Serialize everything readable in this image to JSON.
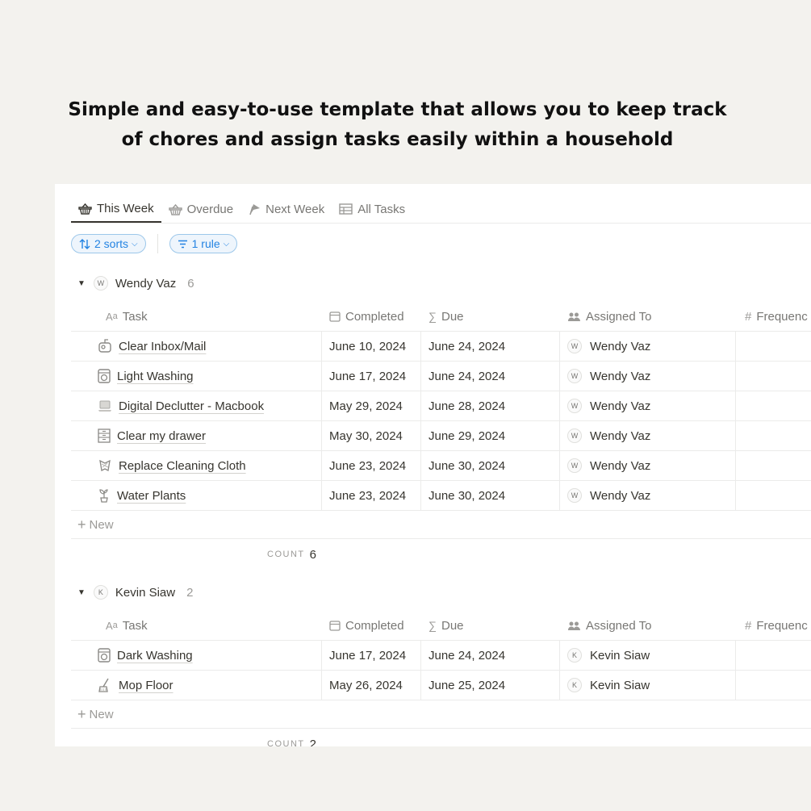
{
  "headline": {
    "line1": "Simple and easy-to-use template that allows you to keep track",
    "line2": "of chores and assign tasks easily within a household"
  },
  "tabs": [
    {
      "label": "This Week",
      "icon": "basket-icon",
      "active": true
    },
    {
      "label": "Overdue",
      "icon": "basket-icon",
      "active": false
    },
    {
      "label": "Next Week",
      "icon": "flag-icon",
      "active": false
    },
    {
      "label": "All Tasks",
      "icon": "table-icon",
      "active": false
    }
  ],
  "filters": {
    "sorts_label": "2 sorts",
    "rule_label": "1 rule"
  },
  "columns": {
    "task": "Task",
    "completed": "Completed",
    "due": "Due",
    "assigned": "Assigned To",
    "frequency": "Frequenc"
  },
  "new_label": "New",
  "count_label": "COUNT",
  "groups": [
    {
      "name": "Wendy Vaz",
      "initial": "W",
      "count": "6",
      "rows": [
        {
          "task": "Clear Inbox/Mail",
          "icon": "mailbox-icon",
          "completed": "June 10, 2024",
          "due": "June 24, 2024",
          "assigned": "Wendy Vaz",
          "initial": "W"
        },
        {
          "task": "Light Washing",
          "icon": "washing-machine-icon",
          "completed": "June 17, 2024",
          "due": "June 24, 2024",
          "assigned": "Wendy Vaz",
          "initial": "W"
        },
        {
          "task": "Digital Declutter - Macbook",
          "icon": "laptop-icon",
          "completed": "May 29, 2024",
          "due": "June 28, 2024",
          "assigned": "Wendy Vaz",
          "initial": "W"
        },
        {
          "task": "Clear my drawer",
          "icon": "drawer-icon",
          "completed": "May 30, 2024",
          "due": "June 29, 2024",
          "assigned": "Wendy Vaz",
          "initial": "W"
        },
        {
          "task": "Replace Cleaning Cloth",
          "icon": "cloth-icon",
          "completed": "June 23, 2024",
          "due": "June 30, 2024",
          "assigned": "Wendy Vaz",
          "initial": "W"
        },
        {
          "task": "Water Plants",
          "icon": "plant-icon",
          "completed": "June 23, 2024",
          "due": "June 30, 2024",
          "assigned": "Wendy Vaz",
          "initial": "W"
        }
      ],
      "count_value": "6"
    },
    {
      "name": "Kevin Siaw",
      "initial": "K",
      "count": "2",
      "rows": [
        {
          "task": "Dark Washing",
          "icon": "washing-machine-icon",
          "completed": "June 17, 2024",
          "due": "June 24, 2024",
          "assigned": "Kevin Siaw",
          "initial": "K"
        },
        {
          "task": "Mop Floor",
          "icon": "mop-icon",
          "completed": "May 26, 2024",
          "due": "June 25, 2024",
          "assigned": "Kevin Siaw",
          "initial": "K"
        }
      ],
      "count_value": "2"
    }
  ]
}
